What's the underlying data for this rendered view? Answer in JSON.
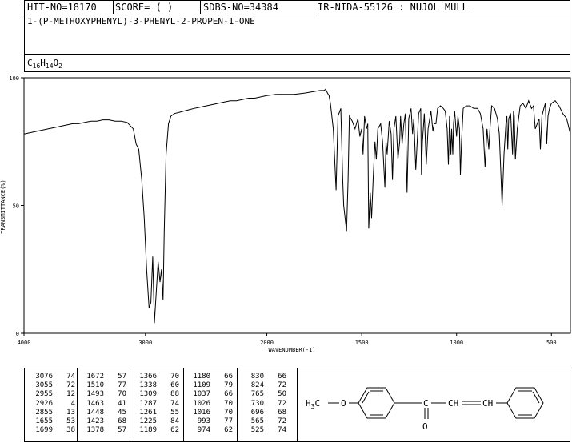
{
  "header": {
    "hit_no": "HIT-NO=18170",
    "score": "SCORE=  (   )",
    "sdbs_no": "SDBS-NO=34384",
    "method": "IR-NIDA-55126 : NUJOL MULL",
    "compound_name": "1-(P-METHOXYPHENYL)-3-PHENYL-2-PROPEN-1-ONE",
    "formula": {
      "c": "C",
      "c_n": "16",
      "h": "H",
      "h_n": "14",
      "o": "O",
      "o_n": "2"
    }
  },
  "chart_data": {
    "type": "line",
    "xlabel": "WAVENUMBER(-1)",
    "ylabel": "TRANSMITTANCE(%)",
    "xlim": [
      4000,
      400
    ],
    "ylim": [
      0,
      100
    ],
    "x_reversed": true,
    "x_ticks": [
      "4000",
      "3000",
      "2000",
      "1500",
      "1000",
      "500"
    ],
    "x_tick_values": [
      4000,
      3000,
      2000,
      1500,
      1000,
      500
    ],
    "y_ticks": [
      "0",
      "50",
      "100"
    ],
    "y_tick_values": [
      0,
      50,
      100
    ],
    "series": [
      {
        "x": [
          4000,
          3950,
          3900,
          3850,
          3800,
          3750,
          3700,
          3650,
          3600,
          3550,
          3500,
          3450,
          3400,
          3350,
          3300,
          3250,
          3200,
          3150,
          3100,
          3076,
          3055,
          3030,
          3010,
          2990,
          2970,
          2955,
          2940,
          2926,
          2912,
          2895,
          2880,
          2868,
          2855,
          2845,
          2830,
          2810,
          2790,
          2760,
          2720,
          2680,
          2640,
          2600,
          2550,
          2500,
          2450,
          2400,
          2350,
          2300,
          2250,
          2200,
          2150,
          2100,
          2050,
          2000,
          1950,
          1900,
          1855,
          1800,
          1760,
          1720,
          1699,
          1690,
          1680,
          1672,
          1665,
          1650,
          1635,
          1625,
          1610,
          1600,
          1595,
          1580,
          1572,
          1565,
          1550,
          1535,
          1520,
          1510,
          1500,
          1493,
          1485,
          1475,
          1468,
          1463,
          1455,
          1448,
          1440,
          1430,
          1423,
          1415,
          1400,
          1390,
          1378,
          1372,
          1366,
          1355,
          1345,
          1338,
          1330,
          1320,
          1309,
          1300,
          1295,
          1287,
          1278,
          1270,
          1261,
          1252,
          1240,
          1232,
          1225,
          1215,
          1200,
          1189,
          1185,
          1180,
          1170,
          1160,
          1150,
          1135,
          1125,
          1118,
          1109,
          1100,
          1085,
          1070,
          1060,
          1050,
          1043,
          1037,
          1030,
          1026,
          1020,
          1016,
          1010,
          1000,
          993,
          985,
          980,
          974,
          965,
          950,
          930,
          910,
          890,
          875,
          860,
          850,
          840,
          830,
          824,
          815,
          800,
          785,
          775,
          765,
          760,
          750,
          740,
          735,
          730,
          725,
          715,
          705,
          700,
          696,
          690,
          680,
          665,
          650,
          635,
          620,
          605,
          595,
          585,
          575,
          565,
          558,
          550,
          540,
          532,
          525,
          518,
          510,
          500,
          480,
          460,
          440,
          420,
          400
        ],
        "y": [
          78,
          78.5,
          79,
          79.5,
          80,
          80.5,
          81,
          81.5,
          82,
          82,
          82.5,
          83,
          83,
          83.5,
          83.5,
          83,
          83,
          82.5,
          80,
          74,
          72,
          60,
          45,
          25,
          10,
          12,
          30,
          4,
          15,
          28,
          20,
          25,
          13,
          40,
          70,
          82,
          85,
          86,
          86.5,
          87,
          87.5,
          88,
          88.5,
          89,
          89.5,
          90,
          90.5,
          91,
          91,
          91.5,
          92,
          92,
          92.5,
          93,
          93.5,
          93.5,
          93.5,
          94,
          94.5,
          95,
          95,
          95.5,
          94,
          93,
          90,
          80,
          56,
          85,
          88,
          60,
          50,
          40,
          60,
          85,
          83,
          80,
          84,
          77,
          80,
          70,
          85,
          80,
          82,
          41,
          55,
          45,
          60,
          75,
          68,
          80,
          82,
          75,
          57,
          75,
          70,
          83,
          78,
          60,
          80,
          85,
          68,
          75,
          85,
          74,
          82,
          86,
          55,
          84,
          88,
          78,
          84,
          64,
          86,
          88,
          62,
          75,
          86,
          66,
          80,
          87,
          79,
          82,
          82,
          88,
          89,
          88,
          87,
          80,
          66,
          85,
          70,
          80,
          70,
          82,
          87,
          77,
          85,
          80,
          62,
          75,
          88,
          89,
          89,
          88,
          88,
          86,
          80,
          65,
          80,
          72,
          80,
          89,
          88,
          84,
          78,
          60,
          50,
          70,
          82,
          85,
          72,
          84,
          86,
          70,
          87,
          85,
          68,
          80,
          89,
          90,
          88,
          91,
          88,
          89,
          80,
          82,
          84,
          72,
          85,
          88,
          90,
          74,
          85,
          88,
          90,
          91,
          89,
          86,
          84,
          78
        ]
      }
    ],
    "peak_table": [
      [
        [
          "3076",
          "74"
        ],
        [
          "3055",
          "72"
        ],
        [
          "2955",
          "12"
        ],
        [
          "2926",
          "4"
        ],
        [
          "2855",
          "13"
        ],
        [
          "1655",
          "53"
        ],
        [
          "1699",
          "38"
        ]
      ],
      [
        [
          "1672",
          "57"
        ],
        [
          "1510",
          "77"
        ],
        [
          "1493",
          "70"
        ],
        [
          "1463",
          "41"
        ],
        [
          "1448",
          "45"
        ],
        [
          "1423",
          "68"
        ],
        [
          "1378",
          "57"
        ]
      ],
      [
        [
          "1366",
          "70"
        ],
        [
          "1338",
          "60"
        ],
        [
          "1309",
          "88"
        ],
        [
          "1287",
          "74"
        ],
        [
          "1261",
          "55"
        ],
        [
          "1225",
          "84"
        ],
        [
          "1189",
          "62"
        ]
      ],
      [
        [
          "1180",
          "66"
        ],
        [
          "1109",
          "79"
        ],
        [
          "1037",
          "66"
        ],
        [
          "1026",
          "70"
        ],
        [
          "1016",
          "70"
        ],
        [
          "993",
          "77"
        ],
        [
          "974",
          "62"
        ]
      ],
      [
        [
          "830",
          "66"
        ],
        [
          "824",
          "72"
        ],
        [
          "765",
          "50"
        ],
        [
          "730",
          "72"
        ],
        [
          "696",
          "68"
        ],
        [
          "565",
          "72"
        ],
        [
          "525",
          "74"
        ]
      ]
    ]
  },
  "structure": {
    "h3c": "H",
    "h3c_sub": "3",
    "c_label": "C",
    "o_ether": "O",
    "o_carbonyl": "O",
    "ch1": "CH",
    "ch2": "CH",
    "h_ch": "H"
  }
}
